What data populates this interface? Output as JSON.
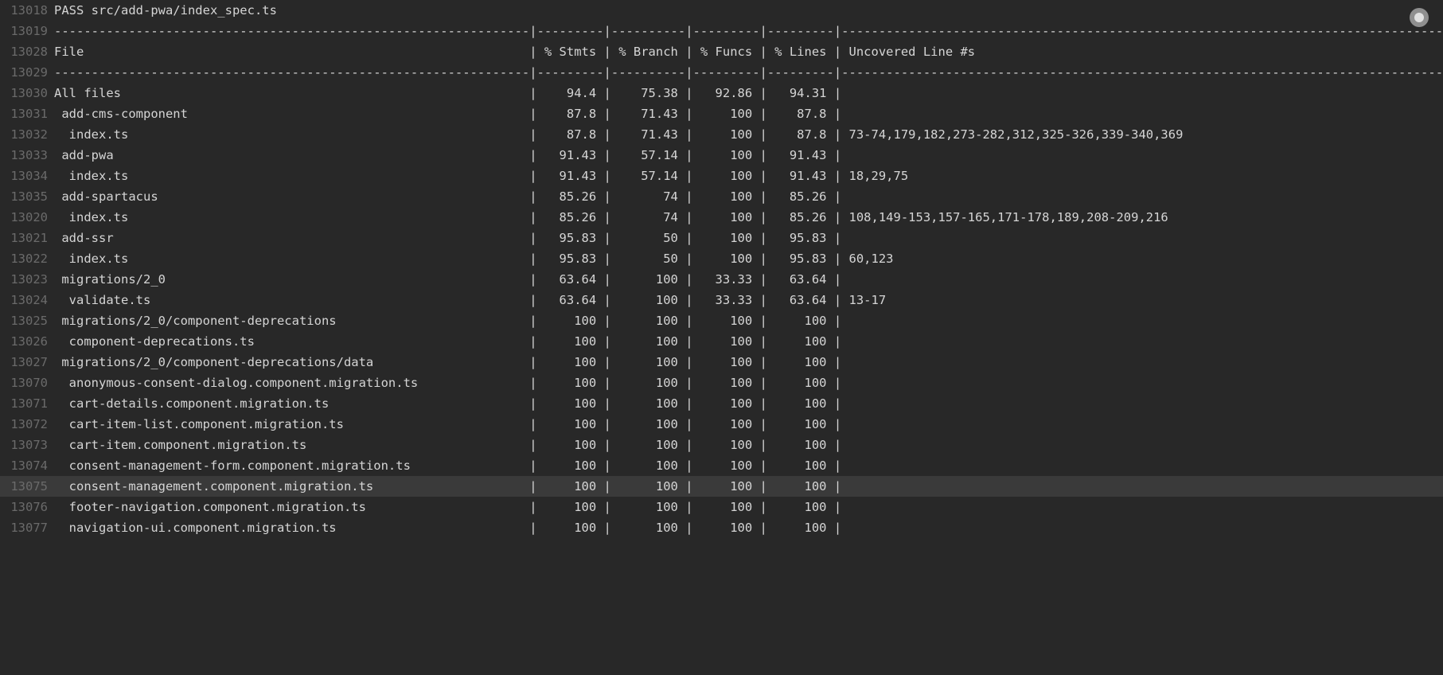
{
  "status_badge": {
    "label": "pending"
  },
  "pass_line": {
    "line": "13018",
    "text": "PASS src/add-pwa/index_spec.ts"
  },
  "sep1": {
    "line": "13019",
    "text": "----------------------------------------------------------------|---------|----------|---------|---------|----------------------------------------------------------------------------------------"
  },
  "header": {
    "line": "13028",
    "text": "File                                                            | % Stmts | % Branch | % Funcs | % Lines | Uncovered Line #s"
  },
  "sep2": {
    "line": "13029",
    "text": "----------------------------------------------------------------|---------|----------|---------|---------|----------------------------------------------------------------------------------------"
  },
  "rows": [
    {
      "line": "13030",
      "file": "All files",
      "indent": 0,
      "stmts": "94.4",
      "branch": "75.38",
      "funcs": "92.86",
      "lines": "94.31",
      "unc": ""
    },
    {
      "line": "13031",
      "file": "add-cms-component",
      "indent": 1,
      "stmts": "87.8",
      "branch": "71.43",
      "funcs": "100",
      "lines": "87.8",
      "unc": ""
    },
    {
      "line": "13032",
      "file": "index.ts",
      "indent": 2,
      "stmts": "87.8",
      "branch": "71.43",
      "funcs": "100",
      "lines": "87.8",
      "unc": "73-74,179,182,273-282,312,325-326,339-340,369"
    },
    {
      "line": "13033",
      "file": "add-pwa",
      "indent": 1,
      "stmts": "91.43",
      "branch": "57.14",
      "funcs": "100",
      "lines": "91.43",
      "unc": ""
    },
    {
      "line": "13034",
      "file": "index.ts",
      "indent": 2,
      "stmts": "91.43",
      "branch": "57.14",
      "funcs": "100",
      "lines": "91.43",
      "unc": "18,29,75"
    },
    {
      "line": "13035",
      "file": "add-spartacus",
      "indent": 1,
      "stmts": "85.26",
      "branch": "74",
      "funcs": "100",
      "lines": "85.26",
      "unc": ""
    },
    {
      "line": "13020",
      "file": "index.ts",
      "indent": 2,
      "stmts": "85.26",
      "branch": "74",
      "funcs": "100",
      "lines": "85.26",
      "unc": "108,149-153,157-165,171-178,189,208-209,216"
    },
    {
      "line": "13021",
      "file": "add-ssr",
      "indent": 1,
      "stmts": "95.83",
      "branch": "50",
      "funcs": "100",
      "lines": "95.83",
      "unc": ""
    },
    {
      "line": "13022",
      "file": "index.ts",
      "indent": 2,
      "stmts": "95.83",
      "branch": "50",
      "funcs": "100",
      "lines": "95.83",
      "unc": "60,123"
    },
    {
      "line": "13023",
      "file": "migrations/2_0",
      "indent": 1,
      "stmts": "63.64",
      "branch": "100",
      "funcs": "33.33",
      "lines": "63.64",
      "unc": ""
    },
    {
      "line": "13024",
      "file": "validate.ts",
      "indent": 2,
      "stmts": "63.64",
      "branch": "100",
      "funcs": "33.33",
      "lines": "63.64",
      "unc": "13-17"
    },
    {
      "line": "13025",
      "file": "migrations/2_0/component-deprecations",
      "indent": 1,
      "stmts": "100",
      "branch": "100",
      "funcs": "100",
      "lines": "100",
      "unc": ""
    },
    {
      "line": "13026",
      "file": "component-deprecations.ts",
      "indent": 2,
      "stmts": "100",
      "branch": "100",
      "funcs": "100",
      "lines": "100",
      "unc": ""
    },
    {
      "line": "13027",
      "file": "migrations/2_0/component-deprecations/data",
      "indent": 1,
      "stmts": "100",
      "branch": "100",
      "funcs": "100",
      "lines": "100",
      "unc": ""
    },
    {
      "line": "13070",
      "file": "anonymous-consent-dialog.component.migration.ts",
      "indent": 2,
      "stmts": "100",
      "branch": "100",
      "funcs": "100",
      "lines": "100",
      "unc": ""
    },
    {
      "line": "13071",
      "file": "cart-details.component.migration.ts",
      "indent": 2,
      "stmts": "100",
      "branch": "100",
      "funcs": "100",
      "lines": "100",
      "unc": ""
    },
    {
      "line": "13072",
      "file": "cart-item-list.component.migration.ts",
      "indent": 2,
      "stmts": "100",
      "branch": "100",
      "funcs": "100",
      "lines": "100",
      "unc": ""
    },
    {
      "line": "13073",
      "file": "cart-item.component.migration.ts",
      "indent": 2,
      "stmts": "100",
      "branch": "100",
      "funcs": "100",
      "lines": "100",
      "unc": ""
    },
    {
      "line": "13074",
      "file": "consent-management-form.component.migration.ts",
      "indent": 2,
      "stmts": "100",
      "branch": "100",
      "funcs": "100",
      "lines": "100",
      "unc": ""
    },
    {
      "line": "13075",
      "file": "consent-management.component.migration.ts",
      "indent": 2,
      "stmts": "100",
      "branch": "100",
      "funcs": "100",
      "lines": "100",
      "unc": "",
      "hl": true
    },
    {
      "line": "13076",
      "file": "footer-navigation.component.migration.ts",
      "indent": 2,
      "stmts": "100",
      "branch": "100",
      "funcs": "100",
      "lines": "100",
      "unc": ""
    },
    {
      "line": "13077",
      "file": "navigation-ui.component.migration.ts",
      "indent": 2,
      "stmts": "100",
      "branch": "100",
      "funcs": "100",
      "lines": "100",
      "unc": ""
    }
  ],
  "widths": {
    "file": 64,
    "stmts": 9,
    "branch": 10,
    "funcs": 9,
    "lines": 9
  }
}
